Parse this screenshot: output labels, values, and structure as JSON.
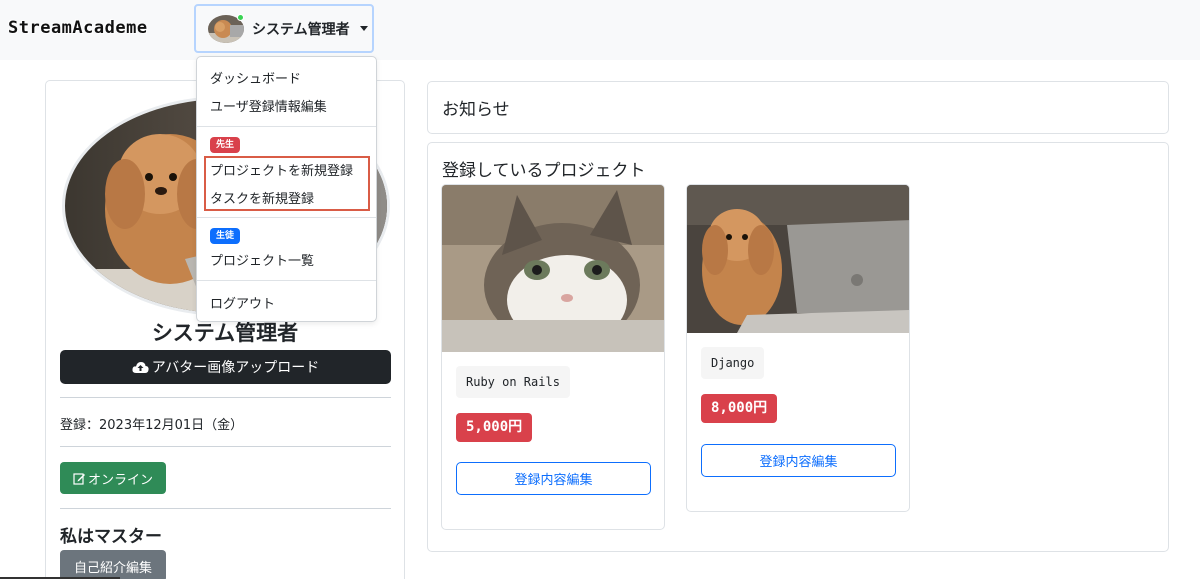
{
  "brand": "StreamAcademe",
  "navbar": {
    "user_name": "システム管理者"
  },
  "dropdown": {
    "items_top": [
      "ダッシュボード",
      "ユーザ登録情報編集"
    ],
    "teacher_badge": "先生",
    "teacher_items": [
      "プロジェクトを新規登録",
      "タスクを新規登録"
    ],
    "student_badge": "生徒",
    "student_items": [
      "プロジェクト一覧"
    ],
    "logout": "ログアウト"
  },
  "profile": {
    "name": "システム管理者",
    "upload_label": "アバター画像アップロード",
    "registered": "登録：2023年12月01日（金）",
    "online_label": "オンライン",
    "bio": "私はマスター",
    "intro_edit_label": "自己紹介編集"
  },
  "notice": {
    "title": "お知らせ"
  },
  "projects": {
    "title": "登録しているプロジェクト",
    "items": [
      {
        "tag": "Ruby on Rails",
        "price": "5,000円",
        "edit_label": "登録内容編集",
        "image": "kitten-photo"
      },
      {
        "tag": "Django",
        "price": "8,000円",
        "edit_label": "登録内容編集",
        "image": "poodle-laptop-photo"
      }
    ]
  },
  "colors": {
    "navbar_bg": "#f8f9fa",
    "dark_button": "#212529",
    "success": "#2f8b57",
    "secondary": "#6c757d",
    "danger": "#d9414b",
    "primary": "#0d6efd",
    "teacher_badge": "#d9414b",
    "student_badge": "#0d6efd",
    "highlight": "#d95c46"
  }
}
